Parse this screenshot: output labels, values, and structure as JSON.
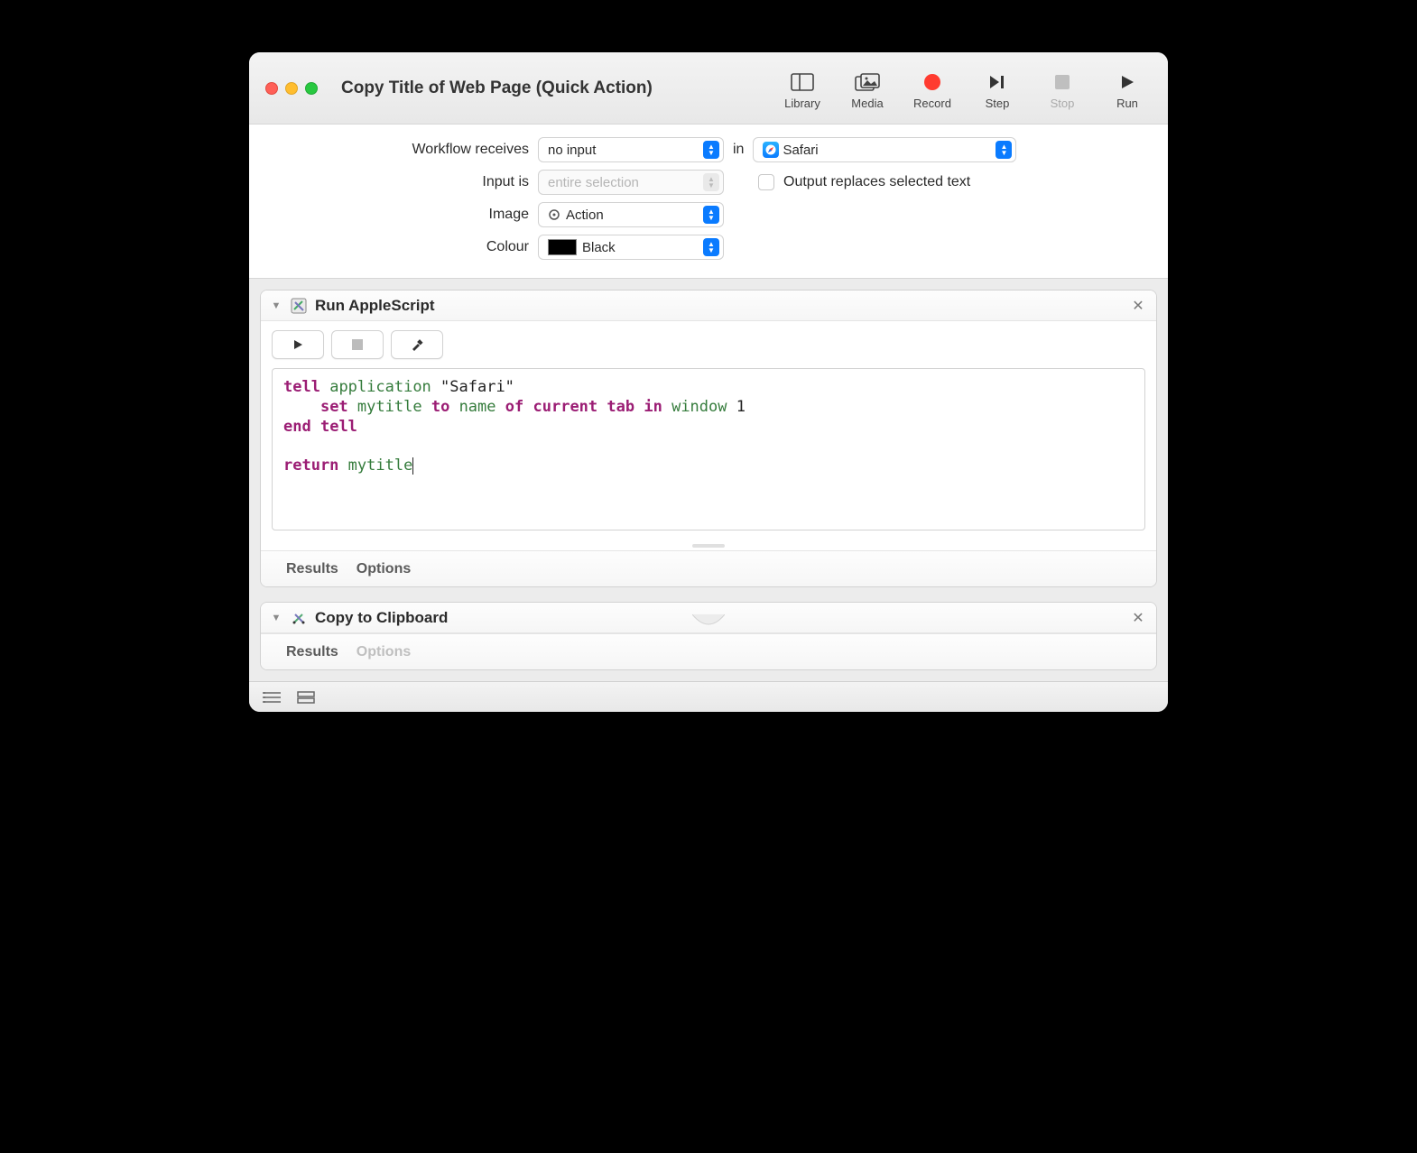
{
  "window": {
    "title": "Copy Title of Web Page (Quick Action)"
  },
  "toolbar": {
    "library": "Library",
    "media": "Media",
    "record": "Record",
    "step": "Step",
    "stop": "Stop",
    "run": "Run"
  },
  "settings": {
    "workflow_receives_label": "Workflow receives",
    "workflow_receives_value": "no input",
    "in_label": "in",
    "app_value": "Safari",
    "input_is_label": "Input is",
    "input_is_value": "entire selection",
    "output_replaces_label": "Output replaces selected text",
    "image_label": "Image",
    "image_value": "Action",
    "colour_label": "Colour",
    "colour_value": "Black"
  },
  "actions": [
    {
      "title": "Run AppleScript",
      "code_lines": [
        {
          "segments": [
            {
              "t": "kw",
              "v": "tell"
            },
            {
              "t": "str",
              "v": " "
            },
            {
              "t": "id",
              "v": "application"
            },
            {
              "t": "str",
              "v": " \"Safari\""
            }
          ]
        },
        {
          "segments": [
            {
              "t": "str",
              "v": "    "
            },
            {
              "t": "kw",
              "v": "set"
            },
            {
              "t": "str",
              "v": " "
            },
            {
              "t": "id",
              "v": "mytitle"
            },
            {
              "t": "str",
              "v": " "
            },
            {
              "t": "kw",
              "v": "to"
            },
            {
              "t": "str",
              "v": " "
            },
            {
              "t": "id",
              "v": "name"
            },
            {
              "t": "str",
              "v": " "
            },
            {
              "t": "kw",
              "v": "of"
            },
            {
              "t": "str",
              "v": " "
            },
            {
              "t": "kw",
              "v": "current tab"
            },
            {
              "t": "str",
              "v": " "
            },
            {
              "t": "kw",
              "v": "in"
            },
            {
              "t": "str",
              "v": " "
            },
            {
              "t": "id",
              "v": "window"
            },
            {
              "t": "str",
              "v": " 1"
            }
          ]
        },
        {
          "segments": [
            {
              "t": "kw",
              "v": "end"
            },
            {
              "t": "str",
              "v": " "
            },
            {
              "t": "kw",
              "v": "tell"
            }
          ]
        },
        {
          "segments": []
        },
        {
          "segments": [
            {
              "t": "kw",
              "v": "return"
            },
            {
              "t": "str",
              "v": " "
            },
            {
              "t": "id",
              "v": "mytitle"
            }
          ],
          "caret": true
        }
      ],
      "footer": {
        "results": "Results",
        "options": "Options"
      }
    },
    {
      "title": "Copy to Clipboard",
      "footer": {
        "results": "Results",
        "options": "Options"
      }
    }
  ]
}
